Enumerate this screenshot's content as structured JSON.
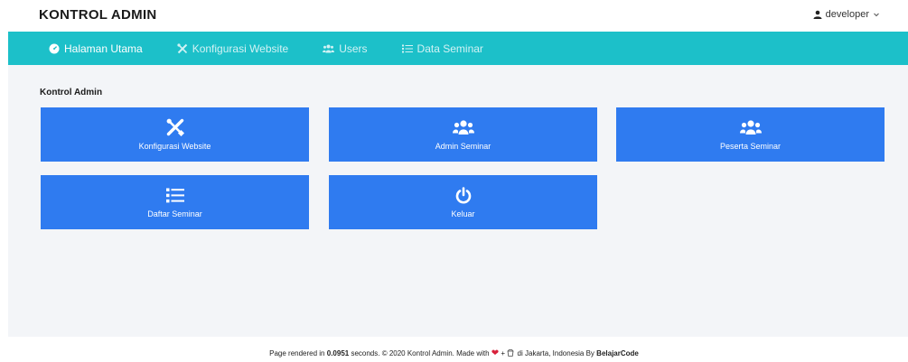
{
  "header": {
    "brand": "KONTROL ADMIN",
    "user": "developer"
  },
  "nav": {
    "items": [
      {
        "label": "Halaman Utama",
        "icon": "dashboard-icon",
        "active": true
      },
      {
        "label": "Konfigurasi Website",
        "icon": "tools-icon",
        "active": false
      },
      {
        "label": "Users",
        "icon": "users-icon",
        "active": false
      },
      {
        "label": "Data Seminar",
        "icon": "list-icon",
        "active": false
      }
    ]
  },
  "main": {
    "section_title": "Kontrol Admin",
    "tiles": [
      {
        "label": "Konfigurasi Website",
        "icon": "tools-icon"
      },
      {
        "label": "Admin Seminar",
        "icon": "users-icon"
      },
      {
        "label": "Peserta Seminar",
        "icon": "users-icon"
      },
      {
        "label": "Daftar Seminar",
        "icon": "list-icon"
      },
      {
        "label": "Keluar",
        "icon": "power-icon"
      }
    ]
  },
  "footer": {
    "prefix": "Page rendered in",
    "time": "0.0951",
    "middle": "seconds. © 2020 Kontrol Admin. Made with",
    "plus": "+",
    "location": "di Jakarta, Indonesia By",
    "author": "BelajarCode"
  },
  "colors": {
    "navbar": "#1cc0c9",
    "tile": "#2f7bf0",
    "content_bg": "#f3f5f8",
    "heart": "#d8203a"
  }
}
